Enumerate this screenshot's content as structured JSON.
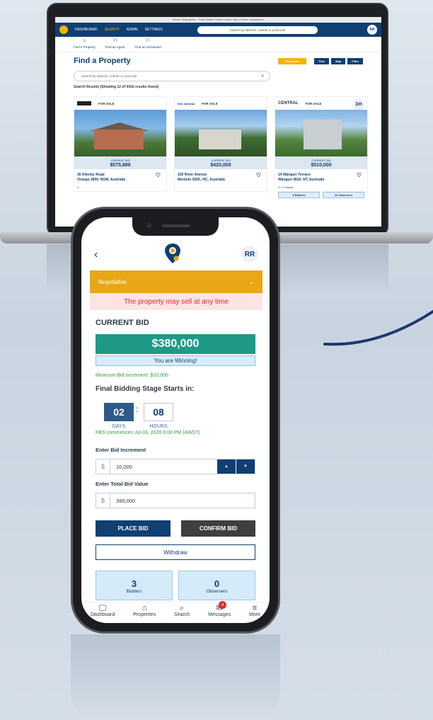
{
  "laptop": {
    "titlebar": "Dealer Negotiation · Real Estate Online Auction App | Dealer Negotiation",
    "nav": [
      "DASHBOARD",
      "SEARCH",
      "ADMIN",
      "SETTINGS"
    ],
    "search_placeholder": "Search by address, suburb or postcode",
    "avatar": "AR",
    "subnav": [
      {
        "label": "Find a Property",
        "icon": "home-icon"
      },
      {
        "label": "Find an Agent",
        "icon": "people-icon"
      },
      {
        "label": "Find an Auctioneer",
        "icon": "flag-icon"
      }
    ],
    "page_title": "Find a Property",
    "view_buttons": [
      "Properties",
      "Tiles",
      "Map",
      "Filter"
    ],
    "page_search_placeholder": "Search by address, suburb or postcode",
    "results_text": "Search Results (Showing 12 of 4416 results found)",
    "cards": [
      {
        "status": "FOR SALE",
        "bid_label": "CURRENT BID",
        "bid": "$575,888",
        "address": "36 Allenby Road",
        "suburb": "Orange 2800, NSW, Australia",
        "meta": "4",
        "bidders": "",
        "observers": "",
        "badge": ""
      },
      {
        "status": "FOR SALE",
        "bid_label": "CURRENT BID",
        "bid": "$420,000",
        "address": "229 River Avenue",
        "suburb": "Merbein 3505, VIC, Australia",
        "meta": "",
        "bidders": "",
        "observers": "",
        "badge": "",
        "brand": "first national"
      },
      {
        "status": "FOR SALE",
        "bid_label": "CURRENT BID",
        "bid": "$510,000",
        "address": "14 Wanguri Terrace",
        "suburb": "Wanguri 0810, NT, Australia",
        "meta": "3  2  4  House",
        "bidders": "8 Bidders",
        "observers": "22 Observers",
        "badge": "DH",
        "brand": "CENTRAL"
      }
    ]
  },
  "phone": {
    "avatar": "RR",
    "status_section": "Negotiation",
    "warning": "The property may sell at any time",
    "current_bid_label": "CURRENT BID",
    "current_bid": "$380,000",
    "winning_text": "You are Winning!",
    "min_increment": "Minimum Bid Increment: $10,000",
    "fbs_title": "Final Bidding Stage Starts in:",
    "countdown": {
      "days": "02",
      "hours": "08",
      "days_label": "DAYS",
      "hours_label": "HOURS"
    },
    "fbs_commences": "FBS commences Jul 03, 2020 6:00 PM (AWST)",
    "bid_increment_label": "Enter Bid Increment",
    "bid_increment_value": "10,000",
    "total_bid_label": "Enter Total Bid Value",
    "total_bid_value": "390,000",
    "currency": "$",
    "place_bid": "PLACE BID",
    "confirm_bid": "CONFIRM BID",
    "withdraw": "Withdraw",
    "bidders_count": "3",
    "bidders_label": "Bidders",
    "observers_count": "0",
    "observers_label": "Observers",
    "tabs": [
      {
        "label": "Dashboard",
        "icon": "monitor-icon"
      },
      {
        "label": "Properties",
        "icon": "home-icon"
      },
      {
        "label": "Search",
        "icon": "search-icon"
      },
      {
        "label": "Messages",
        "icon": "mail-icon",
        "badge": "4"
      },
      {
        "label": "More",
        "icon": "menu-icon"
      }
    ]
  },
  "colors": {
    "brand": "#0f3f73",
    "accent": "#e8a716",
    "success": "#1f9a86",
    "danger": "#e02929"
  }
}
